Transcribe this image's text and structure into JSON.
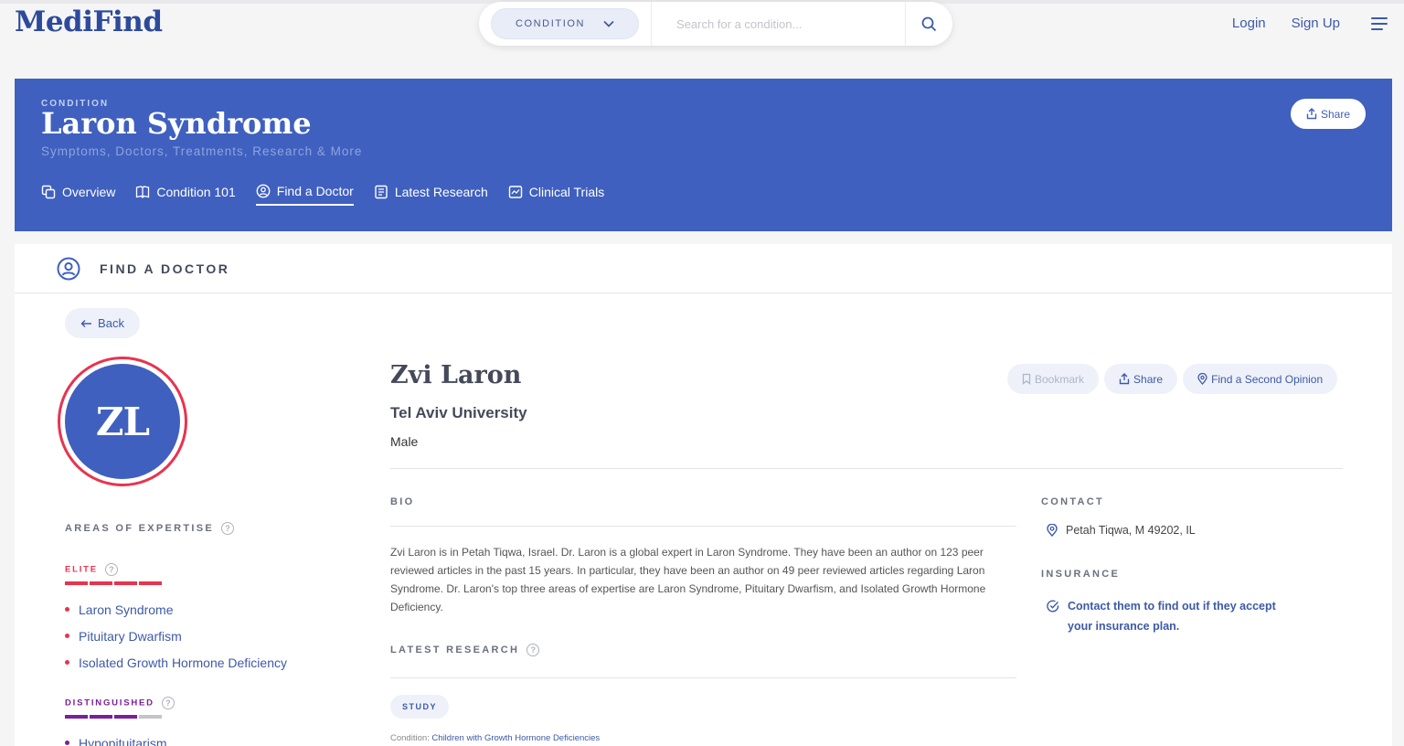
{
  "header": {
    "logo": "MediFind",
    "search": {
      "category_label": "CONDITION",
      "placeholder": "Search for a condition..."
    },
    "login": "Login",
    "signup": "Sign Up"
  },
  "banner": {
    "kicker": "CONDITION",
    "title": "Laron Syndrome",
    "subtitle": "Symptoms, Doctors, Treatments, Research & More",
    "share_label": "Share",
    "tabs": [
      {
        "label": "Overview",
        "icon": "copy-icon",
        "active": false
      },
      {
        "label": "Condition 101",
        "icon": "book-icon",
        "active": false
      },
      {
        "label": "Find a Doctor",
        "icon": "user-circle-icon",
        "active": true
      },
      {
        "label": "Latest Research",
        "icon": "document-icon",
        "active": false
      },
      {
        "label": "Clinical Trials",
        "icon": "chart-icon",
        "active": false
      }
    ]
  },
  "section": {
    "title": "FIND A DOCTOR",
    "back_label": "Back"
  },
  "doctor": {
    "initials": "ZL",
    "name": "Zvi Laron",
    "institution": "Tel Aviv University",
    "gender": "Male",
    "actions": {
      "bookmark": "Bookmark",
      "share": "Share",
      "second_opinion": "Find a Second Opinion"
    },
    "bio_label": "BIO",
    "bio": "Zvi Laron is in Petah Tiqwa, Israel. Dr. Laron is a global expert in Laron Syndrome. They have been an author on 123 peer reviewed articles in the past 15 years. In particular, they have been an author on 49 peer reviewed articles regarding Laron Syndrome. Dr. Laron's top three areas of expertise are Laron Syndrome, Pituitary Dwarfism, and Isolated Growth Hormone Deficiency.",
    "latest_research_label": "LATEST RESEARCH",
    "study_badge": "STUDY",
    "study_condition_prefix": "Condition:",
    "study_condition_value": "Children with Growth Hormone Deficiencies",
    "contact_label": "CONTACT",
    "location": "Petah Tiqwa, M 49202, IL",
    "insurance_label": "INSURANCE",
    "insurance_text": "Contact them to find out if they accept your insurance plan."
  },
  "expertise": {
    "label": "AREAS OF EXPERTISE",
    "tiers": [
      {
        "name": "ELITE",
        "color": "#e8334f",
        "level_of_4": 4,
        "items": [
          "Laron Syndrome",
          "Pituitary Dwarfism",
          "Isolated Growth Hormone Deficiency"
        ]
      },
      {
        "name": "DISTINGUISHED",
        "color": "#7b1f9a",
        "level_of_4": 3,
        "items": [
          "Hypopituitarism"
        ]
      }
    ]
  },
  "colors": {
    "brand": "#3f60bf",
    "elite": "#e8334f",
    "distinguished": "#7b1f9a"
  }
}
